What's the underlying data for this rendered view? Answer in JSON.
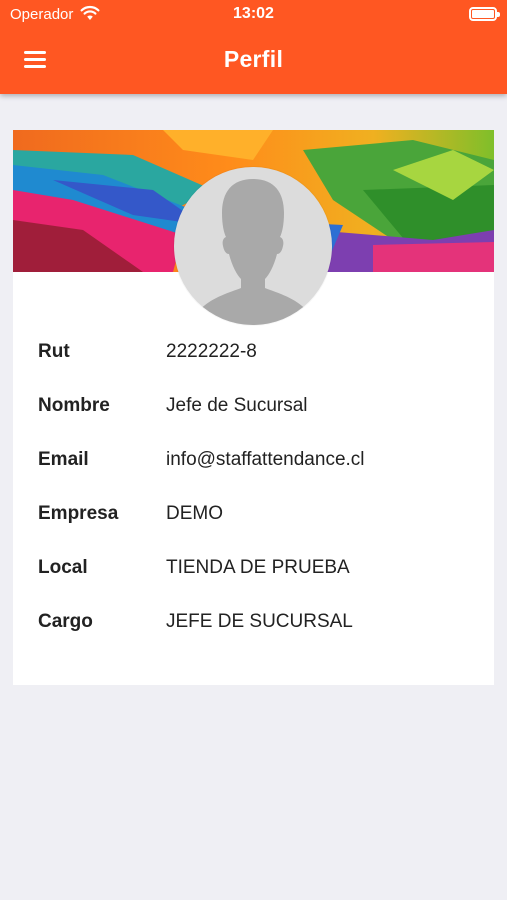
{
  "status_bar": {
    "carrier": "Operador",
    "time": "13:02"
  },
  "app_bar": {
    "title": "Perfil",
    "background": "#ff5722",
    "menu_icon": "hamburger-menu-icon"
  },
  "profile": {
    "cover_image": "colorful-painted-abstract",
    "avatar_icon": "default-user-silhouette-icon",
    "fields": [
      {
        "label": "Rut",
        "value": "2222222-8"
      },
      {
        "label": "Nombre",
        "value": "Jefe de Sucursal"
      },
      {
        "label": "Email",
        "value": "info@staffattendance.cl"
      },
      {
        "label": "Empresa",
        "value": "DEMO"
      },
      {
        "label": "Local",
        "value": "TIENDA DE PRUEBA"
      },
      {
        "label": "Cargo",
        "value": "JEFE DE SUCURSAL"
      }
    ]
  }
}
